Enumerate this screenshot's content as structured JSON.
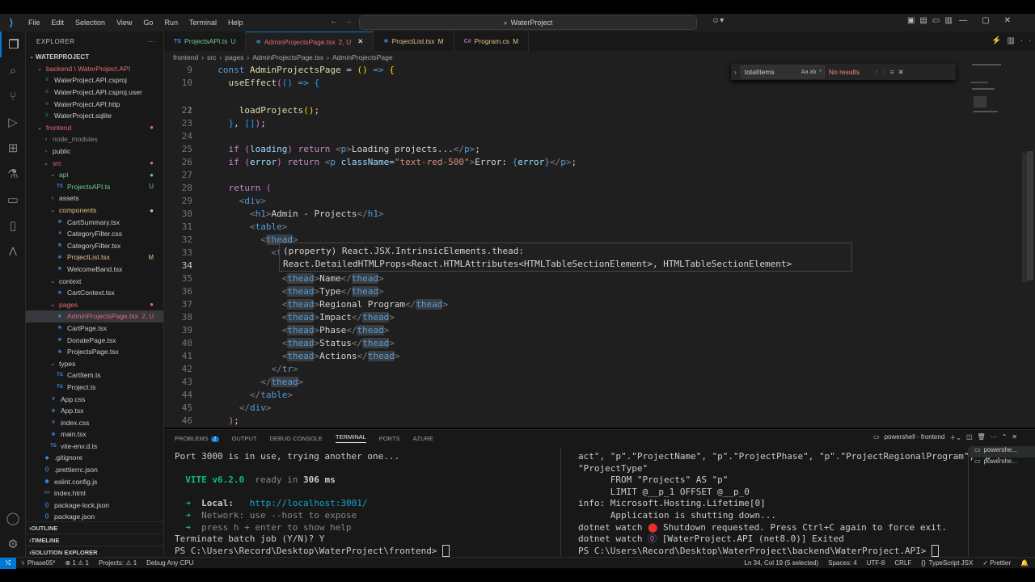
{
  "titlebar": {
    "menu": [
      "File",
      "Edit",
      "Selection",
      "View",
      "Go",
      "Run",
      "Terminal",
      "Help"
    ],
    "search": "WaterProject"
  },
  "sidebar": {
    "header": "EXPLORER",
    "root": "WATERPROJECT",
    "items": [
      {
        "label": "backend \\ WaterProject.API",
        "indent": 1,
        "type": "folder",
        "open": true,
        "badge": "",
        "color": "red"
      },
      {
        "label": "WaterProject.API.csproj",
        "indent": 2,
        "type": "file",
        "icon": "≡",
        "badge": ""
      },
      {
        "label": "WaterProject.API.csproj.user",
        "indent": 2,
        "type": "file",
        "icon": "≡",
        "badge": ""
      },
      {
        "label": "WaterProject.API.http",
        "indent": 2,
        "type": "file",
        "icon": "≡",
        "badge": ""
      },
      {
        "label": "WaterProject.sqlite",
        "indent": 2,
        "type": "file",
        "icon": "≡",
        "badge": ""
      },
      {
        "label": "frontend",
        "indent": 1,
        "type": "folder",
        "open": true,
        "badge": "●",
        "color": "red"
      },
      {
        "label": "node_modules",
        "indent": 2,
        "type": "folder",
        "open": false,
        "badge": "",
        "color": "dim"
      },
      {
        "label": "public",
        "indent": 2,
        "type": "folder",
        "open": false,
        "badge": ""
      },
      {
        "label": "src",
        "indent": 2,
        "type": "folder",
        "open": true,
        "badge": "●",
        "color": "red"
      },
      {
        "label": "api",
        "indent": 3,
        "type": "folder",
        "open": true,
        "badge": "●",
        "color": "green"
      },
      {
        "label": "ProjectsAPI.ts",
        "indent": 4,
        "type": "file",
        "icon": "TS",
        "badge": "U",
        "color": "green"
      },
      {
        "label": "assets",
        "indent": 3,
        "type": "folder",
        "open": false,
        "badge": ""
      },
      {
        "label": "components",
        "indent": 3,
        "type": "folder",
        "open": true,
        "badge": "●",
        "color": "yellow"
      },
      {
        "label": "CartSummary.tsx",
        "indent": 4,
        "type": "file",
        "icon": "⚛",
        "badge": ""
      },
      {
        "label": "CategoryFilter.css",
        "indent": 4,
        "type": "file",
        "icon": "#",
        "badge": ""
      },
      {
        "label": "CategoryFilter.tsx",
        "indent": 4,
        "type": "file",
        "icon": "⚛",
        "badge": ""
      },
      {
        "label": "ProjectList.tsx",
        "indent": 4,
        "type": "file",
        "icon": "⚛",
        "badge": "M",
        "color": "yellow"
      },
      {
        "label": "WelcomeBand.tsx",
        "indent": 4,
        "type": "file",
        "icon": "⚛",
        "badge": ""
      },
      {
        "label": "context",
        "indent": 3,
        "type": "folder",
        "open": true,
        "badge": ""
      },
      {
        "label": "CartContext.tsx",
        "indent": 4,
        "type": "file",
        "icon": "⚛",
        "badge": ""
      },
      {
        "label": "pages",
        "indent": 3,
        "type": "folder",
        "open": true,
        "badge": "●",
        "color": "red"
      },
      {
        "label": "AdminProjectsPage.tsx",
        "indent": 4,
        "type": "file",
        "icon": "⚛",
        "badge": "2, U",
        "color": "red",
        "selected": true
      },
      {
        "label": "CartPage.tsx",
        "indent": 4,
        "type": "file",
        "icon": "⚛",
        "badge": ""
      },
      {
        "label": "DonatePage.tsx",
        "indent": 4,
        "type": "file",
        "icon": "⚛",
        "badge": ""
      },
      {
        "label": "ProjectsPage.tsx",
        "indent": 4,
        "type": "file",
        "icon": "⚛",
        "badge": ""
      },
      {
        "label": "types",
        "indent": 3,
        "type": "folder",
        "open": true,
        "badge": ""
      },
      {
        "label": "CartItem.ts",
        "indent": 4,
        "type": "file",
        "icon": "TS",
        "badge": ""
      },
      {
        "label": "Project.ts",
        "indent": 4,
        "type": "file",
        "icon": "TS",
        "badge": ""
      },
      {
        "label": "App.css",
        "indent": 3,
        "type": "file",
        "icon": "#",
        "badge": ""
      },
      {
        "label": "App.tsx",
        "indent": 3,
        "type": "file",
        "icon": "⚛",
        "badge": ""
      },
      {
        "label": "index.css",
        "indent": 3,
        "type": "file",
        "icon": "#",
        "badge": ""
      },
      {
        "label": "main.tsx",
        "indent": 3,
        "type": "file",
        "icon": "⚛",
        "badge": ""
      },
      {
        "label": "vite-env.d.ts",
        "indent": 3,
        "type": "file",
        "icon": "TS",
        "badge": ""
      },
      {
        "label": ".gitignore",
        "indent": 2,
        "type": "file",
        "icon": "◆",
        "badge": ""
      },
      {
        "label": ".prettierrc.json",
        "indent": 2,
        "type": "file",
        "icon": "{}",
        "badge": ""
      },
      {
        "label": "eslint.config.js",
        "indent": 2,
        "type": "file",
        "icon": "◉",
        "badge": ""
      },
      {
        "label": "index.html",
        "indent": 2,
        "type": "file",
        "icon": "<>",
        "badge": ""
      },
      {
        "label": "package-lock.json",
        "indent": 2,
        "type": "file",
        "icon": "{}",
        "badge": ""
      },
      {
        "label": "package.json",
        "indent": 2,
        "type": "file",
        "icon": "{}",
        "badge": ""
      }
    ],
    "sections": [
      "OUTLINE",
      "TIMELINE",
      "SOLUTION EXPLORER"
    ]
  },
  "tabs": [
    {
      "icon": "TS",
      "label": "ProjectsAPI.ts",
      "status": "U",
      "active": false
    },
    {
      "icon": "⚛",
      "label": "AdminProjectsPage.tsx",
      "status": "2, U",
      "active": true
    },
    {
      "icon": "⚛",
      "label": "ProjectList.tsx",
      "status": "M",
      "active": false
    },
    {
      "icon": "C#",
      "label": "Program.cs",
      "status": "M",
      "active": false
    }
  ],
  "breadcrumb": [
    "frontend",
    "src",
    "pages",
    "AdminProjectsPage.tsx",
    "AdminProjectsPage"
  ],
  "find": {
    "value": "totalItems",
    "result": "No results",
    "opt1": "Aa",
    "opt2": "ab",
    "opt3": ".*"
  },
  "hover": {
    "line1": "(property) React.JSX.IntrinsicElements.thead:",
    "line2": "React.DetailedHTMLProps<React.HTMLAttributes<HTMLTableSectionElement>, HTMLTableSectionElement>"
  },
  "panel": {
    "tabs": [
      "PROBLEMS",
      "OUTPUT",
      "DEBUG CONSOLE",
      "TERMINAL",
      "PORTS",
      "AZURE"
    ],
    "problems_count": "2",
    "terminal_name": "powershell - frontend",
    "term_list": [
      "powershe...",
      "powershe..."
    ]
  },
  "terminal_left": {
    "l1": "Port 3000 is in use, trying another one...",
    "vite": "VITE v6.2.0",
    "ready": "ready in",
    "ms": "306 ms",
    "local_label": "Local:",
    "local_url": "http://localhost:3001/",
    "network_label": "Network:",
    "network_text": "use --host to expose",
    "press": "press h + enter to show help",
    "terminate": "Terminate batch job (Y/N)? Y",
    "prompt": "PS C:\\Users\\Record\\Desktop\\WaterProject\\frontend> "
  },
  "terminal_right": {
    "l1": "act\", \"p\".\"ProjectName\", \"p\".\"ProjectPhase\", \"p\".\"ProjectRegionalProgram\", \"p\".",
    "l2": "\"ProjectType\"",
    "l3": "      FROM \"Projects\" AS \"p\"",
    "l4": "      LIMIT @__p_1 OFFSET @__p_0",
    "l5": "info: Microsoft.Hosting.Lifetime[0]",
    "l6": "      Application is shutting down...",
    "l7a": "dotnet watch ",
    "l7b": " Shutdown requested. Press Ctrl+C again to force exit.",
    "l8a": "dotnet watch ",
    "l8b": " [WaterProject.API (net8.0)] Exited",
    "prompt": "PS C:\\Users\\Record\\Desktop\\WaterProject\\backend\\WaterProject.API> "
  },
  "status": {
    "branch": "Phase05*",
    "errors": "⊗ 1 ⚠ 1",
    "projects": "Projects: ⚠ 1",
    "config": "Debug Any CPU",
    "position": "Ln 34, Col 19 (5 selected)",
    "spaces": "Spaces: 4",
    "encoding": "UTF-8",
    "eol": "CRLF",
    "braces": "{}",
    "language": "TypeScript JSX",
    "prettier": "✓ Prettier"
  },
  "colors": {
    "accent": "#0078d4",
    "editor_bg": "#1f1f1f",
    "sidebar_bg": "#181818"
  }
}
